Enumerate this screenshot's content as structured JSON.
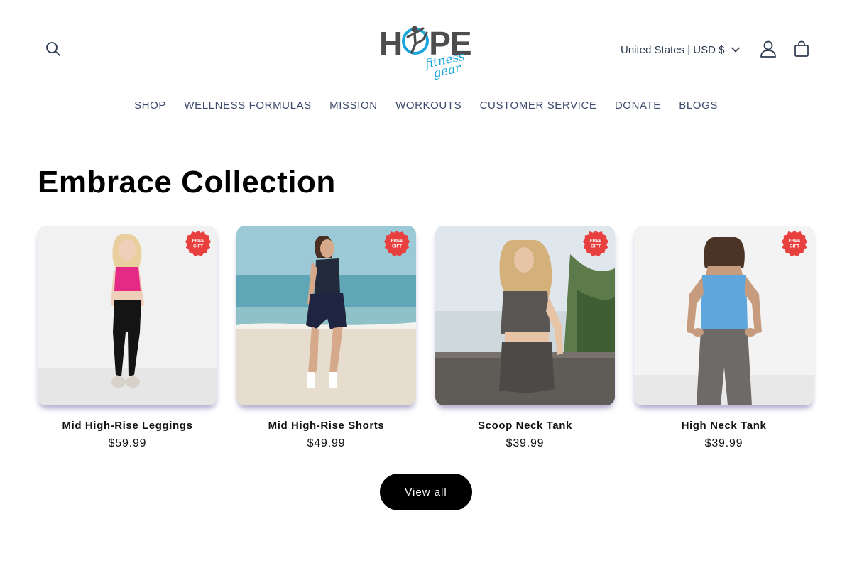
{
  "header": {
    "logo": {
      "main": "HOPE",
      "sub_line1": "fitness",
      "sub_line2": "gear"
    },
    "country_selector": {
      "label": "United States | USD $"
    },
    "icons": {
      "search": "search-icon",
      "account": "user-icon",
      "cart": "bag-icon"
    }
  },
  "nav": {
    "items": [
      {
        "label": "SHOP"
      },
      {
        "label": "WELLNESS FORMULAS"
      },
      {
        "label": "MISSION"
      },
      {
        "label": "WORKOUTS"
      },
      {
        "label": "CUSTOMER SERVICE"
      },
      {
        "label": "DONATE"
      },
      {
        "label": "BLOGS"
      }
    ]
  },
  "collection": {
    "title": "Embrace Collection",
    "badge": {
      "line1": "FREE",
      "line2": "GIFT"
    },
    "products": [
      {
        "name": "Mid High-Rise Leggings",
        "price": "$59.99"
      },
      {
        "name": "Mid High-Rise Shorts",
        "price": "$49.99"
      },
      {
        "name": "Scoop Neck Tank",
        "price": "$39.99"
      },
      {
        "name": "High Neck Tank",
        "price": "$39.99"
      }
    ],
    "view_all": "View all"
  },
  "colors": {
    "accent": "#000000",
    "nav_text": "#3d4a6b",
    "logo_gray": "#4d4d4f",
    "logo_blue": "#1aa6dc",
    "badge_red": "#e8403f"
  }
}
